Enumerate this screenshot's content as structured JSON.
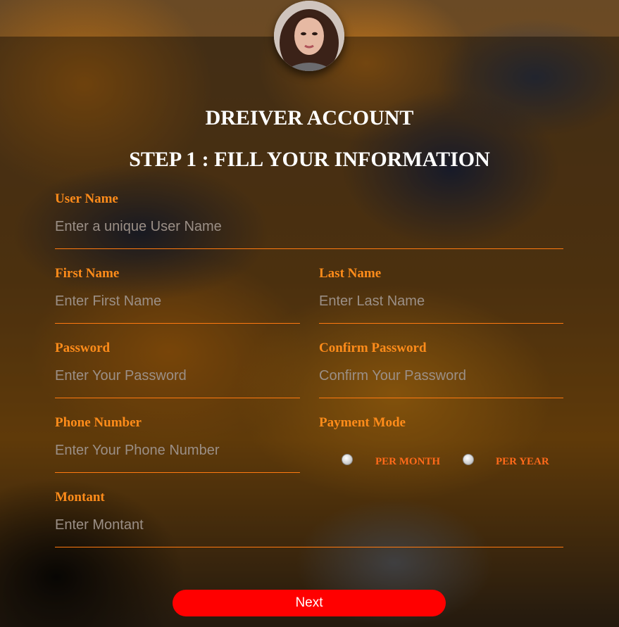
{
  "header": {
    "title": "DREIVER ACCOUNT",
    "subtitle": "STEP 1 : FILL YOUR INFORMATION"
  },
  "form": {
    "username": {
      "label": "User Name",
      "placeholder": "Enter a unique User Name",
      "value": ""
    },
    "first_name": {
      "label": "First Name",
      "placeholder": "Enter First Name",
      "value": ""
    },
    "last_name": {
      "label": "Last Name",
      "placeholder": "Enter Last Name",
      "value": ""
    },
    "password": {
      "label": "Password",
      "placeholder": "Enter Your Password",
      "value": ""
    },
    "confirm_password": {
      "label": "Confirm Password",
      "placeholder": "Confirm Your Password",
      "value": ""
    },
    "phone": {
      "label": "Phone Number",
      "placeholder": "Enter Your Phone Number",
      "value": ""
    },
    "payment_mode": {
      "label": "Payment Mode",
      "options": [
        "PER MONTH",
        "PER YEAR"
      ],
      "selected": null
    },
    "montant": {
      "label": "Montant",
      "placeholder": "Enter Montant",
      "value": ""
    }
  },
  "actions": {
    "next_label": "Next"
  },
  "colors": {
    "accent": "#ff8c1a",
    "radio_label": "#ff6a1a",
    "underline": "#ff7a10",
    "button": "#ff0000",
    "title": "#ffffff"
  },
  "icons": {
    "avatar": "profile-photo"
  }
}
